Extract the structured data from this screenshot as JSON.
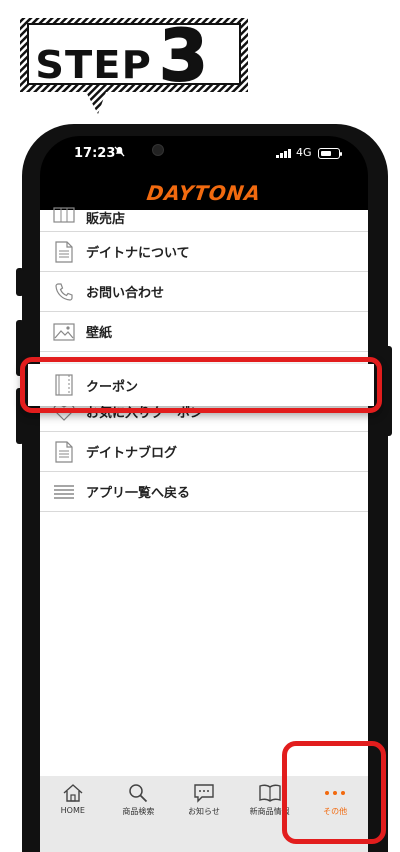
{
  "badge": {
    "word": "STEP",
    "number": "3"
  },
  "status": {
    "time": "17:23",
    "network": "4G"
  },
  "header": {
    "logo_text": "DAYTONA",
    "logo_color": "#f26a0f"
  },
  "menu": {
    "items": [
      {
        "label": "販売店",
        "icon": "store-icon"
      },
      {
        "label": "デイトナについて",
        "icon": "document-icon"
      },
      {
        "label": "お問い合わせ",
        "icon": "phone-icon"
      },
      {
        "label": "壁紙",
        "icon": "image-icon"
      },
      {
        "label": "クーポン",
        "icon": "coupon-icon"
      },
      {
        "label": "お気に入りクーポン",
        "icon": "heart-icon"
      },
      {
        "label": "デイトナブログ",
        "icon": "document-icon"
      },
      {
        "label": "アプリ一覧へ戻る",
        "icon": "list-icon"
      }
    ]
  },
  "tabbar": {
    "tabs": [
      {
        "label": "HOME",
        "icon": "home-icon"
      },
      {
        "label": "商品検索",
        "icon": "search-icon"
      },
      {
        "label": "お知らせ",
        "icon": "message-icon"
      },
      {
        "label": "新商品情報",
        "icon": "book-icon"
      },
      {
        "label": "その他",
        "icon": "more-icon",
        "active": true
      }
    ],
    "active_color": "#f26a0f"
  },
  "highlight_color": "#e21d1d"
}
